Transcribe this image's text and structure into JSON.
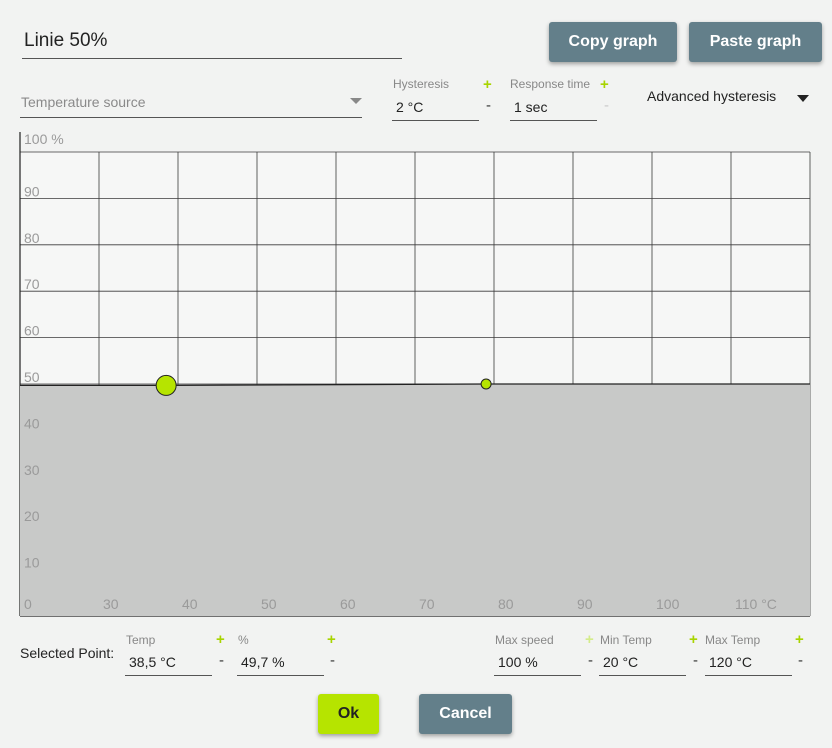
{
  "header": {
    "title": "Linie 50%",
    "copy_label": "Copy graph",
    "paste_label": "Paste graph"
  },
  "controls": {
    "temperature_source_placeholder": "Temperature source",
    "hysteresis": {
      "label": "Hysteresis",
      "value": "2 °C",
      "plus": "+",
      "minus": "-"
    },
    "response_time": {
      "label": "Response time",
      "value": "1 sec",
      "plus": "+",
      "minus": "-"
    },
    "advanced_hysteresis_label": "Advanced hysteresis"
  },
  "chart_data": {
    "type": "line",
    "x_ticks": [
      "0",
      "30",
      "40",
      "50",
      "60",
      "70",
      "80",
      "90",
      "100",
      "110 °C"
    ],
    "y_ticks": [
      "100 %",
      "90",
      "80",
      "70",
      "60",
      "50",
      "40",
      "30",
      "20",
      "10"
    ],
    "xlim": [
      20,
      120
    ],
    "ylim": [
      0,
      100
    ],
    "grid": true,
    "points": [
      {
        "x": 38.5,
        "y": 49.7,
        "selected": true
      },
      {
        "x": 79,
        "y": 50,
        "selected": false
      }
    ],
    "line_color": "#222222",
    "fill_color": "#c8c9c8",
    "point_color": "#b6e400"
  },
  "selected_point": {
    "label": "Selected Point:",
    "temp": {
      "label": "Temp",
      "value": "38,5 °C",
      "plus": "+",
      "minus": "-"
    },
    "percent": {
      "label": "%",
      "value": "49,7 %",
      "plus": "+",
      "minus": "-"
    },
    "max_speed": {
      "label": "Max speed",
      "value": "100 %",
      "plus": "+",
      "minus": "-"
    },
    "min_temp": {
      "label": "Min Temp",
      "value": "20 °C",
      "plus": "+",
      "minus": "-"
    },
    "max_temp": {
      "label": "Max Temp",
      "value": "120 °C",
      "plus": "+",
      "minus": "-"
    }
  },
  "footer": {
    "ok_label": "Ok",
    "cancel_label": "Cancel"
  }
}
